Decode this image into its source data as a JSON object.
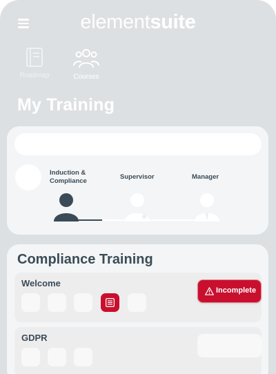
{
  "header": {
    "brand_light": "element",
    "brand_bold": "suite"
  },
  "nav": {
    "items": [
      {
        "label": "Roadmap",
        "icon": "book-icon"
      },
      {
        "label": "Courses",
        "icon": "people-icon"
      }
    ]
  },
  "page": {
    "title": "My Training"
  },
  "progress": {
    "steps": [
      {
        "label_line1": "Induction &",
        "label_line2": "Compliance",
        "state": "active"
      },
      {
        "label_line1": "Supervisor",
        "label_line2": "",
        "state": "inactive"
      },
      {
        "label_line1": "Manager",
        "label_line2": "",
        "state": "inactive"
      }
    ]
  },
  "compliance": {
    "title": "Compliance Training",
    "modules": [
      {
        "title": "Welcome",
        "status": "Incomplete",
        "status_icon": "warning-icon",
        "active_chip_icon": "list-icon"
      },
      {
        "title": "GDPR"
      }
    ]
  },
  "colors": {
    "accent": "#c8102e",
    "text_dark": "#3a4a56",
    "background": "#dde0e3"
  }
}
